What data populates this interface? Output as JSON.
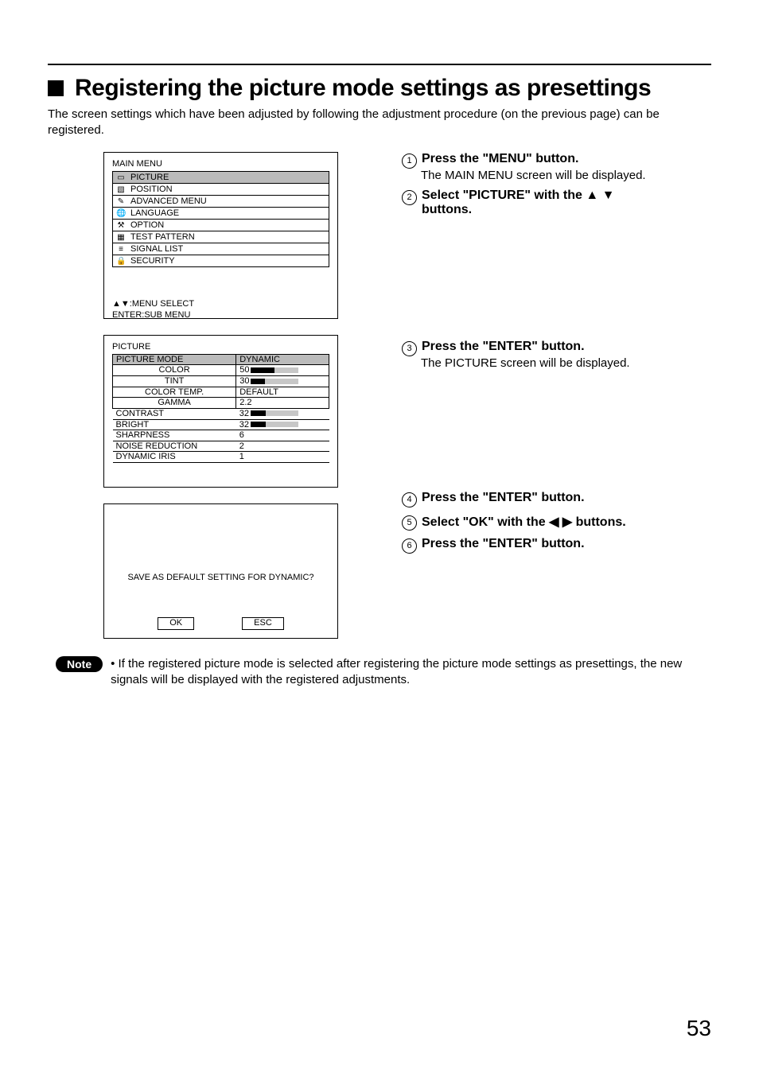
{
  "heading": "Registering the picture mode settings as presettings",
  "intro": "The screen settings which have been adjusted by following the adjustment procedure (on the previous page) can be registered.",
  "main_menu": {
    "title": "MAIN MENU",
    "items": [
      {
        "icon": "▭",
        "label": "PICTURE"
      },
      {
        "icon": "▧",
        "label": "POSITION"
      },
      {
        "icon": "✎",
        "label": "ADVANCED MENU"
      },
      {
        "icon": "🌐",
        "label": "LANGUAGE"
      },
      {
        "icon": "⚒",
        "label": "OPTION"
      },
      {
        "icon": "▦",
        "label": "TEST PATTERN"
      },
      {
        "icon": "≡",
        "label": "SIGNAL LIST"
      },
      {
        "icon": "🔒",
        "label": "SECURITY"
      }
    ],
    "footer1": "▲▼:MENU SELECT",
    "footer2": "ENTER:SUB MENU"
  },
  "picture_menu": {
    "title": "PICTURE",
    "mode_label": "PICTURE MODE",
    "mode_value": "DYNAMIC",
    "subs": [
      {
        "name": "COLOR",
        "value": "50",
        "bar_fill": 50
      },
      {
        "name": "TINT",
        "value": "30",
        "bar_fill": 30
      },
      {
        "name": "COLOR TEMP.",
        "value": "DEFAULT"
      },
      {
        "name": "GAMMA",
        "value": "2.2"
      }
    ],
    "plain": [
      {
        "name": "CONTRAST",
        "value": "32",
        "bar_fill": 32
      },
      {
        "name": "BRIGHT",
        "value": "32",
        "bar_fill": 32
      },
      {
        "name": "SHARPNESS",
        "value": "6"
      },
      {
        "name": "NOISE REDUCTION",
        "value": "2"
      },
      {
        "name": "DYNAMIC IRIS",
        "value": "1"
      }
    ]
  },
  "dialog": {
    "message": "SAVE AS DEFAULT SETTING FOR DYNAMIC?",
    "ok": "OK",
    "esc": "ESC"
  },
  "steps": {
    "s1": {
      "bold": "Press the \"MENU\" button.",
      "sub": "The MAIN MENU screen will be displayed."
    },
    "s2": {
      "bold_pre": "Select \"PICTURE\" with the ",
      "bold_post": " buttons.",
      "arrows": "▲  ▼"
    },
    "s3": {
      "bold": "Press the \"ENTER\" button.",
      "sub": "The PICTURE screen will be displayed."
    },
    "s4": {
      "bold": "Press the \"ENTER\" button."
    },
    "s5": {
      "bold_pre": "Select \"OK\" with the ",
      "bold_post": " buttons.",
      "arrows": "◀  ▶"
    },
    "s6": {
      "bold": "Press the \"ENTER\" button."
    }
  },
  "note_label": "Note",
  "note_text": "• If the registered picture mode is selected after registering the picture mode settings as presettings, the new signals will be displayed with the registered adjustments.",
  "page_number": "53"
}
